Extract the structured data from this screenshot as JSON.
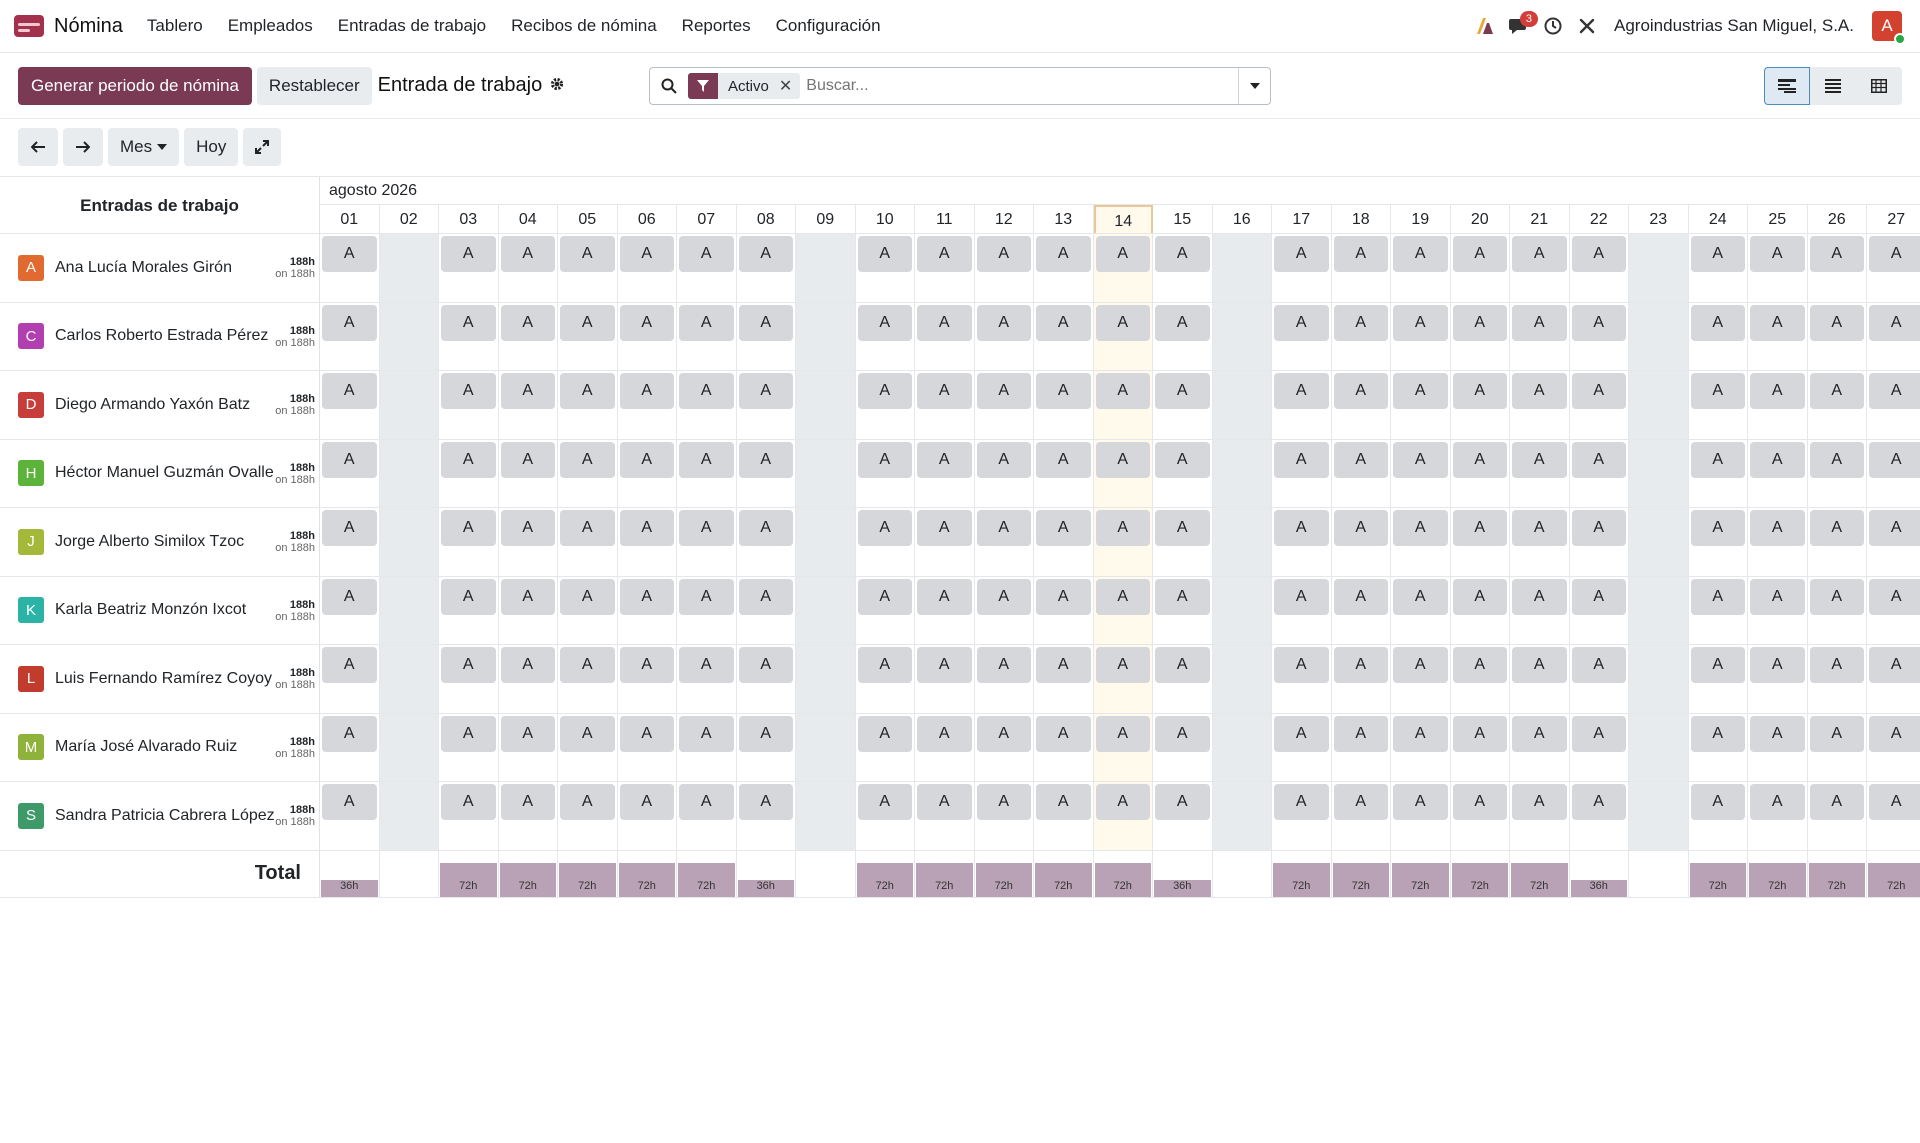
{
  "app": {
    "name": "Nómina"
  },
  "menu": [
    "Tablero",
    "Empleados",
    "Entradas de trabajo",
    "Recibos de nómina",
    "Reportes",
    "Configuración"
  ],
  "navbar": {
    "messages_count": "3",
    "company": "Agroindustrias San Miguel, S.A.",
    "user_initial": "A"
  },
  "control": {
    "generate_label": "Generar periodo de nómina",
    "reset_label": "Restablecer",
    "breadcrumb": "Entrada de trabajo",
    "facet_value": "Activo",
    "search_placeholder": "Buscar..."
  },
  "gantt_toolbar": {
    "scale": "Mes",
    "today": "Hoy"
  },
  "grid": {
    "header_title": "Entradas de trabajo",
    "month_label": "agosto 2026",
    "total_label": "Total",
    "days": [
      "01",
      "02",
      "03",
      "04",
      "05",
      "06",
      "07",
      "08",
      "09",
      "10",
      "11",
      "12",
      "13",
      "14",
      "15",
      "16",
      "17",
      "18",
      "19",
      "20",
      "21",
      "22",
      "23",
      "24",
      "25",
      "26",
      "27"
    ],
    "weekend_days": [
      "02",
      "09",
      "16",
      "23"
    ],
    "today": "14",
    "work_days": [
      "01",
      "03",
      "04",
      "05",
      "06",
      "07",
      "08",
      "10",
      "11",
      "12",
      "13",
      "14",
      "15",
      "17",
      "18",
      "19",
      "20",
      "21",
      "22",
      "24",
      "25",
      "26",
      "27"
    ],
    "pill_label": "A",
    "totals": {
      "01": "36h",
      "03": "72h",
      "04": "72h",
      "05": "72h",
      "06": "72h",
      "07": "72h",
      "08": "36h",
      "10": "72h",
      "11": "72h",
      "12": "72h",
      "13": "72h",
      "14": "72h",
      "15": "36h",
      "17": "72h",
      "18": "72h",
      "19": "72h",
      "20": "72h",
      "21": "72h",
      "22": "36h",
      "24": "72h",
      "25": "72h",
      "26": "72h",
      "27": "72h"
    },
    "employees": [
      {
        "initial": "A",
        "name": "Ana Lucía Morales Girón",
        "hours": "188h",
        "planned": "on 188h",
        "color": "#e06a2f"
      },
      {
        "initial": "C",
        "name": "Carlos Roberto Estrada Pérez",
        "hours": "188h",
        "planned": "on 188h",
        "color": "#b23fb0"
      },
      {
        "initial": "D",
        "name": "Diego Armando Yaxón Batz",
        "hours": "188h",
        "planned": "on 188h",
        "color": "#c73d3a"
      },
      {
        "initial": "H",
        "name": "Héctor Manuel Guzmán Ovalle",
        "hours": "188h",
        "planned": "on 188h",
        "color": "#5bb33a"
      },
      {
        "initial": "J",
        "name": "Jorge Alberto Similox Tzoc",
        "hours": "188h",
        "planned": "on 188h",
        "color": "#a4b83a"
      },
      {
        "initial": "K",
        "name": "Karla Beatriz Monzón Ixcot",
        "hours": "188h",
        "planned": "on 188h",
        "color": "#2bb3a6"
      },
      {
        "initial": "L",
        "name": "Luis Fernando Ramírez Coyoy",
        "hours": "188h",
        "planned": "on 188h",
        "color": "#c23c2e"
      },
      {
        "initial": "M",
        "name": "María José Alvarado Ruiz",
        "hours": "188h",
        "planned": "on 188h",
        "color": "#8fb33a"
      },
      {
        "initial": "S",
        "name": "Sandra Patricia Cabrera López",
        "hours": "188h",
        "planned": "on 188h",
        "color": "#3f9a6a"
      }
    ]
  }
}
